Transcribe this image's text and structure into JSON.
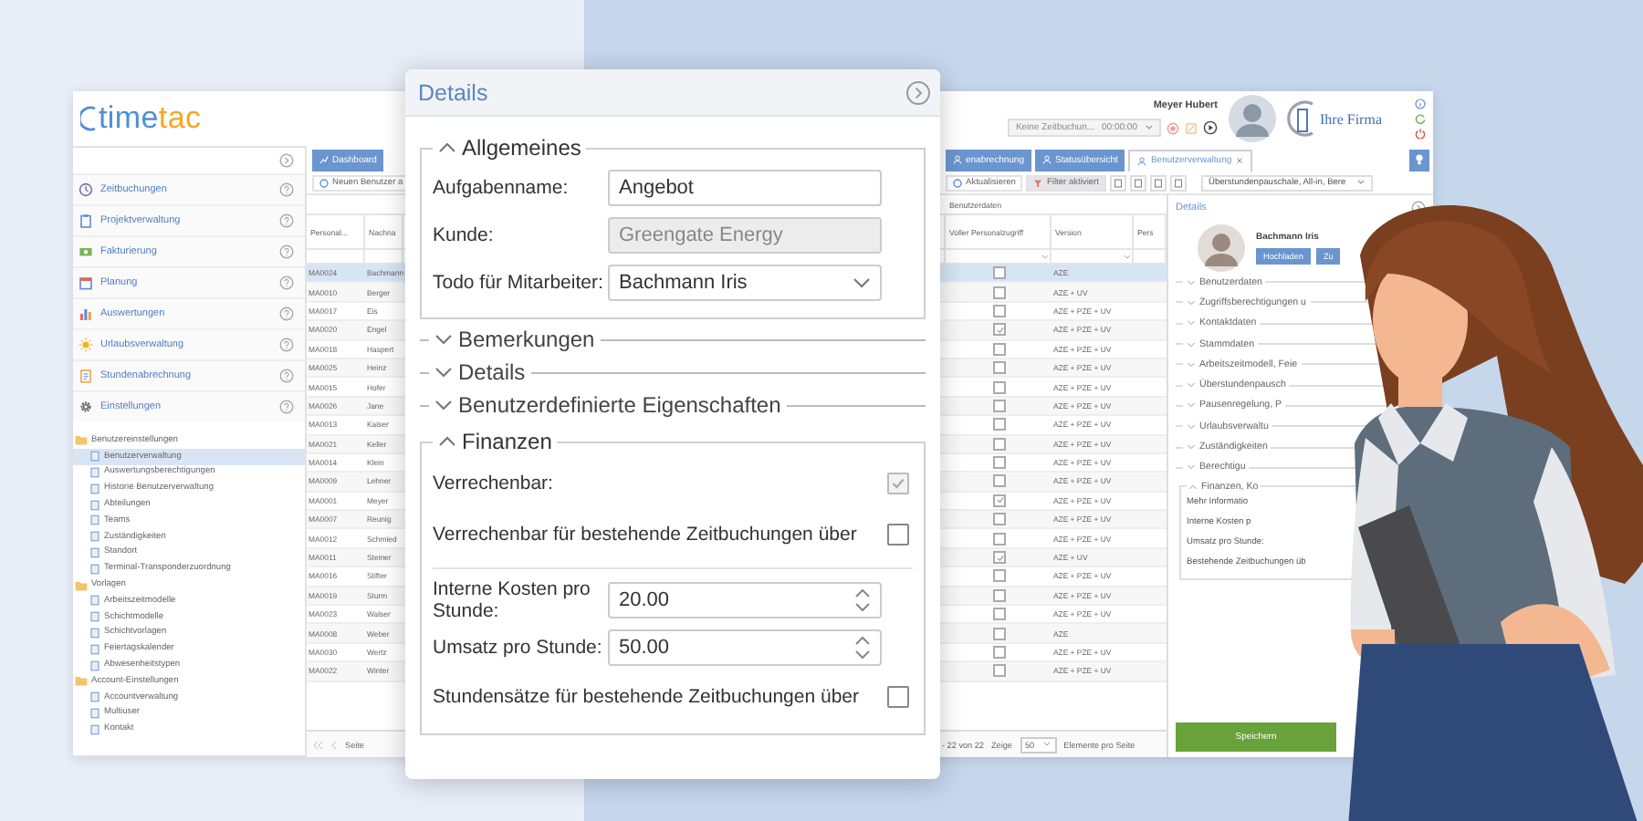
{
  "app": {
    "logo": {
      "start": "time",
      "end": "tac"
    },
    "user": "Meyer Hubert",
    "time_entry": "Keine Zeitbuchun...",
    "timer": "00:00:00",
    "company_logo": "Ihre Firma"
  },
  "sidebar": {
    "modules": [
      "Zeitbuchungen",
      "Projektverwaltung",
      "Fakturierung",
      "Planung",
      "Auswertungen",
      "Urlaubsverwaltung",
      "Stundenabrechnung",
      "Einstellungen"
    ],
    "tree": [
      {
        "label": "Benutzereinstellungen",
        "selected": false,
        "children": [
          {
            "label": "Benutzerverwaltung",
            "selected": true
          },
          {
            "label": "Auswertungsberechtigungen",
            "selected": false
          },
          {
            "label": "Historie Benutzerverwaltung",
            "selected": false
          },
          {
            "label": "Abteilungen",
            "selected": false
          },
          {
            "label": "Teams",
            "selected": false
          },
          {
            "label": "Zuständigkeiten",
            "selected": false
          },
          {
            "label": "Standort",
            "selected": false
          },
          {
            "label": "Terminal-Transponderzuordnung",
            "selected": false
          }
        ]
      },
      {
        "label": "Vorlagen",
        "selected": false,
        "children": [
          {
            "label": "Arbeitszeitmodelle",
            "selected": false
          },
          {
            "label": "Schichtmodelle",
            "selected": false
          },
          {
            "label": "Schichtvorlagen",
            "selected": false
          },
          {
            "label": "Feiertagskalender",
            "selected": false
          },
          {
            "label": "Abwesenheitstypen",
            "selected": false
          }
        ]
      },
      {
        "label": "Account-Einstellungen",
        "selected": false,
        "children": [
          {
            "label": "Accountverwaltung",
            "selected": false
          },
          {
            "label": "Multiuser",
            "selected": false
          },
          {
            "label": "Kontakt",
            "selected": false
          }
        ]
      }
    ]
  },
  "left_tabs": [
    {
      "label": "Dashboard",
      "selected": false
    }
  ],
  "right_tabs": [
    {
      "label": "enabrechnung",
      "selected": false
    },
    {
      "label": "Statusübersicht",
      "selected": false
    },
    {
      "label": "Benutzerverwaltung",
      "selected": true
    }
  ],
  "left_tools": [
    {
      "label": "Neuen Benutzer a",
      "active": false
    }
  ],
  "right_tools": [
    {
      "label": "Aktualisieren",
      "active": false
    },
    {
      "label": "Filter aktiviert",
      "active": true
    }
  ],
  "view_select": "Überstundenpauschale, All-in, Bere",
  "table": {
    "group_header": "Benutzerdaten",
    "columns": [
      "Personal...",
      "Nachna",
      "Voller Personalzugriff",
      "Version",
      "Pers"
    ],
    "rows": [
      {
        "id": "MA0024",
        "name": "Bachmann",
        "full_access": false,
        "version": "AZE",
        "selected": true
      },
      {
        "id": "MA0010",
        "name": "Berger",
        "full_access": false,
        "version": "AZE + UV",
        "selected": false
      },
      {
        "id": "MA0017",
        "name": "Eis",
        "full_access": false,
        "version": "AZE + PZE + UV",
        "selected": false
      },
      {
        "id": "MA0020",
        "name": "Engel",
        "full_access": true,
        "version": "AZE + PZE + UV",
        "selected": false
      },
      {
        "id": "MA0018",
        "name": "Haspert",
        "full_access": false,
        "version": "AZE + PZE + UV",
        "selected": false
      },
      {
        "id": "MA0025",
        "name": "Heinz",
        "full_access": false,
        "version": "AZE + PZE + UV",
        "selected": false
      },
      {
        "id": "MA0015",
        "name": "Hofer",
        "full_access": false,
        "version": "AZE + PZE + UV",
        "selected": false
      },
      {
        "id": "MA0026",
        "name": "Jane",
        "full_access": false,
        "version": "AZE + PZE + UV",
        "selected": false
      },
      {
        "id": "MA0013",
        "name": "Kaiser",
        "full_access": false,
        "version": "AZE + PZE + UV",
        "selected": false
      },
      {
        "id": "MA0021",
        "name": "Keller",
        "full_access": false,
        "version": "AZE + PZE + UV",
        "selected": false
      },
      {
        "id": "MA0014",
        "name": "Klein",
        "full_access": false,
        "version": "AZE + PZE + UV",
        "selected": false
      },
      {
        "id": "MA0009",
        "name": "Lehner",
        "full_access": false,
        "version": "AZE + PZE + UV",
        "selected": false
      },
      {
        "id": "MA0001",
        "name": "Meyer",
        "full_access": true,
        "version": "AZE + PZE + UV",
        "selected": false
      },
      {
        "id": "MA0007",
        "name": "Reunig",
        "full_access": false,
        "version": "AZE + PZE + UV",
        "selected": false
      },
      {
        "id": "MA0012",
        "name": "Schmied",
        "full_access": false,
        "version": "AZE + PZE + UV",
        "selected": false
      },
      {
        "id": "MA0011",
        "name": "Steiner",
        "full_access": true,
        "version": "AZE + UV",
        "selected": false
      },
      {
        "id": "MA0016",
        "name": "Stifter",
        "full_access": false,
        "version": "AZE + PZE + UV",
        "selected": false
      },
      {
        "id": "MA0019",
        "name": "Sturm",
        "full_access": false,
        "version": "AZE + PZE + UV",
        "selected": false
      },
      {
        "id": "MA0023",
        "name": "Walser",
        "full_access": false,
        "version": "AZE + PZE + UV",
        "selected": false
      },
      {
        "id": "MA0008",
        "name": "Weber",
        "full_access": false,
        "version": "AZE",
        "selected": false
      },
      {
        "id": "MA0030",
        "name": "Wertz",
        "full_access": false,
        "version": "AZE + PZE + UV",
        "selected": false
      },
      {
        "id": "MA0022",
        "name": "Winter",
        "full_access": false,
        "version": "AZE + PZE + UV",
        "selected": false
      }
    ]
  },
  "pager": {
    "page_label": "Seite",
    "range": "- 22 von 22",
    "show": "Zeige",
    "per_page": "50",
    "per_page_label": "Elemente pro Seite"
  },
  "details_panel": {
    "title": "Details",
    "name": "Bachmann Iris",
    "buttons": [
      "Hochladen",
      "Zu"
    ],
    "sections": [
      "Benutzerdaten",
      "Zugriffsberechtigungen u",
      "Kontaktdaten",
      "Stammdaten",
      "Arbeitszeitmodell, Feie",
      "Überstundenpausch",
      "Pausenregelung, P",
      "Urlaubsverwaltu",
      "Zuständigkeiten",
      "Berechtigu"
    ],
    "finance": {
      "title": "Finanzen, Ko",
      "lines": [
        "Mehr Informatio",
        "Interne Kosten p",
        "Umsatz pro Stunde:",
        "Bestehende Zeitbuchungen üb"
      ]
    },
    "save": "Speichern"
  },
  "dialog": {
    "title": "Details",
    "sections": [
      {
        "title": "Allgemeines",
        "expanded": true,
        "fields": [
          {
            "kind": "text",
            "label": "Aufgabenname:",
            "value": "Angebot",
            "disabled": false
          },
          {
            "kind": "text",
            "label": "Kunde:",
            "value": "Greengate Energy",
            "disabled": true
          },
          {
            "kind": "select",
            "label": "Todo für Mitarbeiter:",
            "value": "Bachmann Iris",
            "disabled": false
          }
        ]
      },
      {
        "title": "Bemerkungen",
        "expanded": false
      },
      {
        "title": "Details",
        "expanded": false
      },
      {
        "title": "Benutzerdefinierte Eigenschaften",
        "expanded": false
      },
      {
        "title": "Finanzen",
        "expanded": true,
        "fields": [
          {
            "kind": "checkbox",
            "label": "Verrechenbar:",
            "checked": true,
            "disabled": true
          },
          {
            "kind": "checkbox",
            "label": "Verrechenbar für bestehende Zeitbuchungen über",
            "checked": false,
            "disabled": false
          },
          {
            "kind": "number",
            "label": "Interne Kosten pro Stunde:",
            "value": "20.00",
            "disabled": false
          },
          {
            "kind": "number",
            "label": "Umsatz pro Stunde:",
            "value": "50.00",
            "disabled": false
          },
          {
            "kind": "checkbox",
            "label": "Stundensätze für bestehende Zeitbuchungen über",
            "checked": false,
            "disabled": false
          }
        ]
      }
    ]
  }
}
